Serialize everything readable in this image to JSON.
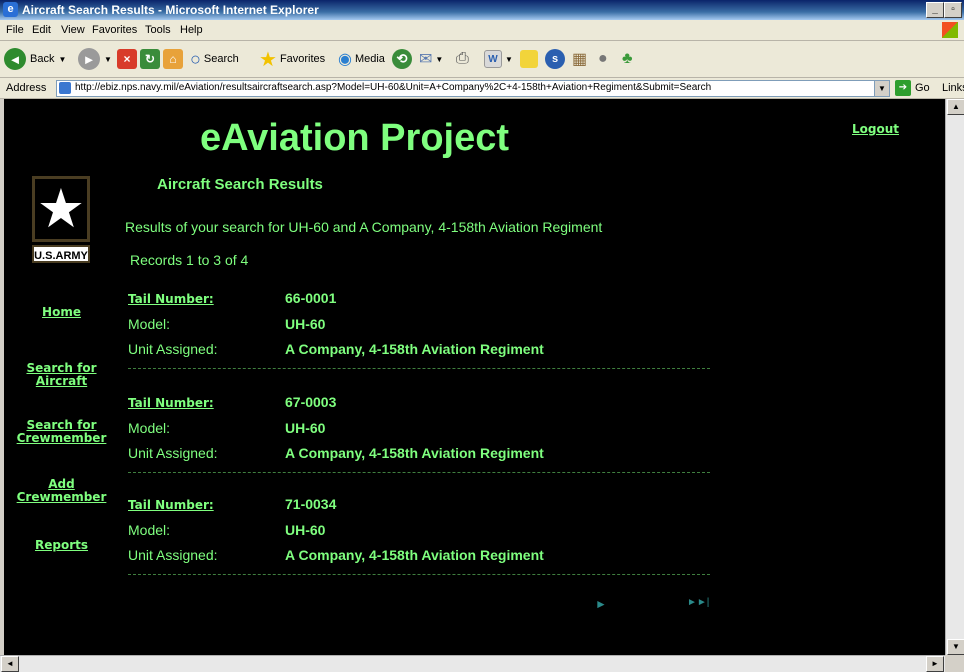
{
  "window": {
    "title": "Aircraft Search Results - Microsoft Internet Explorer"
  },
  "menu": [
    "File",
    "Edit",
    "View",
    "Favorites",
    "Tools",
    "Help"
  ],
  "toolbar": {
    "back": "Back",
    "search": "Search",
    "favorites": "Favorites",
    "media": "Media"
  },
  "address": {
    "label": "Address",
    "url": "http://ebiz.nps.navy.mil/eAviation/resultsaircraftsearch.asp?Model=UH-60&Unit=A+Company%2C+4-158th+Aviation+Regiment&Submit=Search",
    "go": "Go",
    "links": "Links"
  },
  "page": {
    "heading": "eAviation Project",
    "logout": "Logout",
    "subtitle": "Aircraft Search Results",
    "logo_text": "U.S.ARMY",
    "results_message": "Results of your search for UH-60 and A Company, 4-158th Aviation Regiment",
    "records_info": "Records 1 to 3 of 4"
  },
  "nav": {
    "home": "Home",
    "search_aircraft_1": "Search for",
    "search_aircraft_2": "Aircraft",
    "search_crew_1": "Search for",
    "search_crew_2": "Crewmember",
    "add_crew_1": "Add",
    "add_crew_2": "Crewmember",
    "reports": "Reports"
  },
  "labels": {
    "tail": "Tail Number:",
    "model": "Model:",
    "unit": "Unit Assigned:"
  },
  "records": [
    {
      "tail": "66-0001",
      "model": "UH-60",
      "unit": "A Company, 4-158th Aviation Regiment"
    },
    {
      "tail": "67-0003",
      "model": "UH-60",
      "unit": "A Company, 4-158th Aviation Regiment"
    },
    {
      "tail": "71-0034",
      "model": "UH-60",
      "unit": "A Company, 4-158th Aviation Regiment"
    }
  ],
  "pager": {
    "next": "►",
    "last": "►►|"
  }
}
